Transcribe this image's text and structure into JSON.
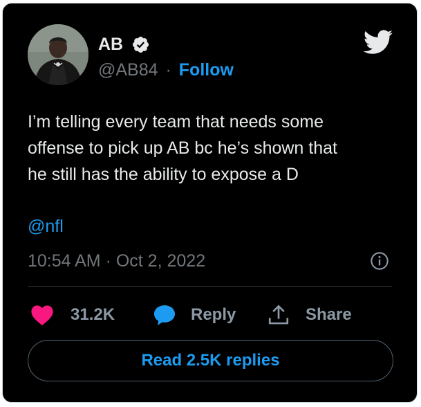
{
  "author": {
    "name": "AB",
    "handle": "@AB84",
    "separator": "·",
    "follow_label": "Follow"
  },
  "tweet": {
    "text": "I’m telling every team that needs some\noffense to pick up AB  bc he’s shown that\nhe still has the ability to expose a D",
    "mention": "@nfl",
    "timestamp": "10:54 AM · Oct 2, 2022"
  },
  "actions": {
    "likes_count": "31.2K",
    "reply_label": "Reply",
    "share_label": "Share"
  },
  "read_replies_label": "Read 2.5K replies",
  "icons": {
    "verified": "verified-badge-icon",
    "logo": "twitter-bird-icon",
    "info": "info-icon",
    "like": "heart-icon",
    "reply": "speech-bubble-icon",
    "share": "share-upload-icon"
  },
  "colors": {
    "background": "#000000",
    "border": "#cfd9de",
    "text": "#e7e9ea",
    "muted": "#71767b",
    "accent": "#1d9bf0",
    "like": "#f91880"
  }
}
